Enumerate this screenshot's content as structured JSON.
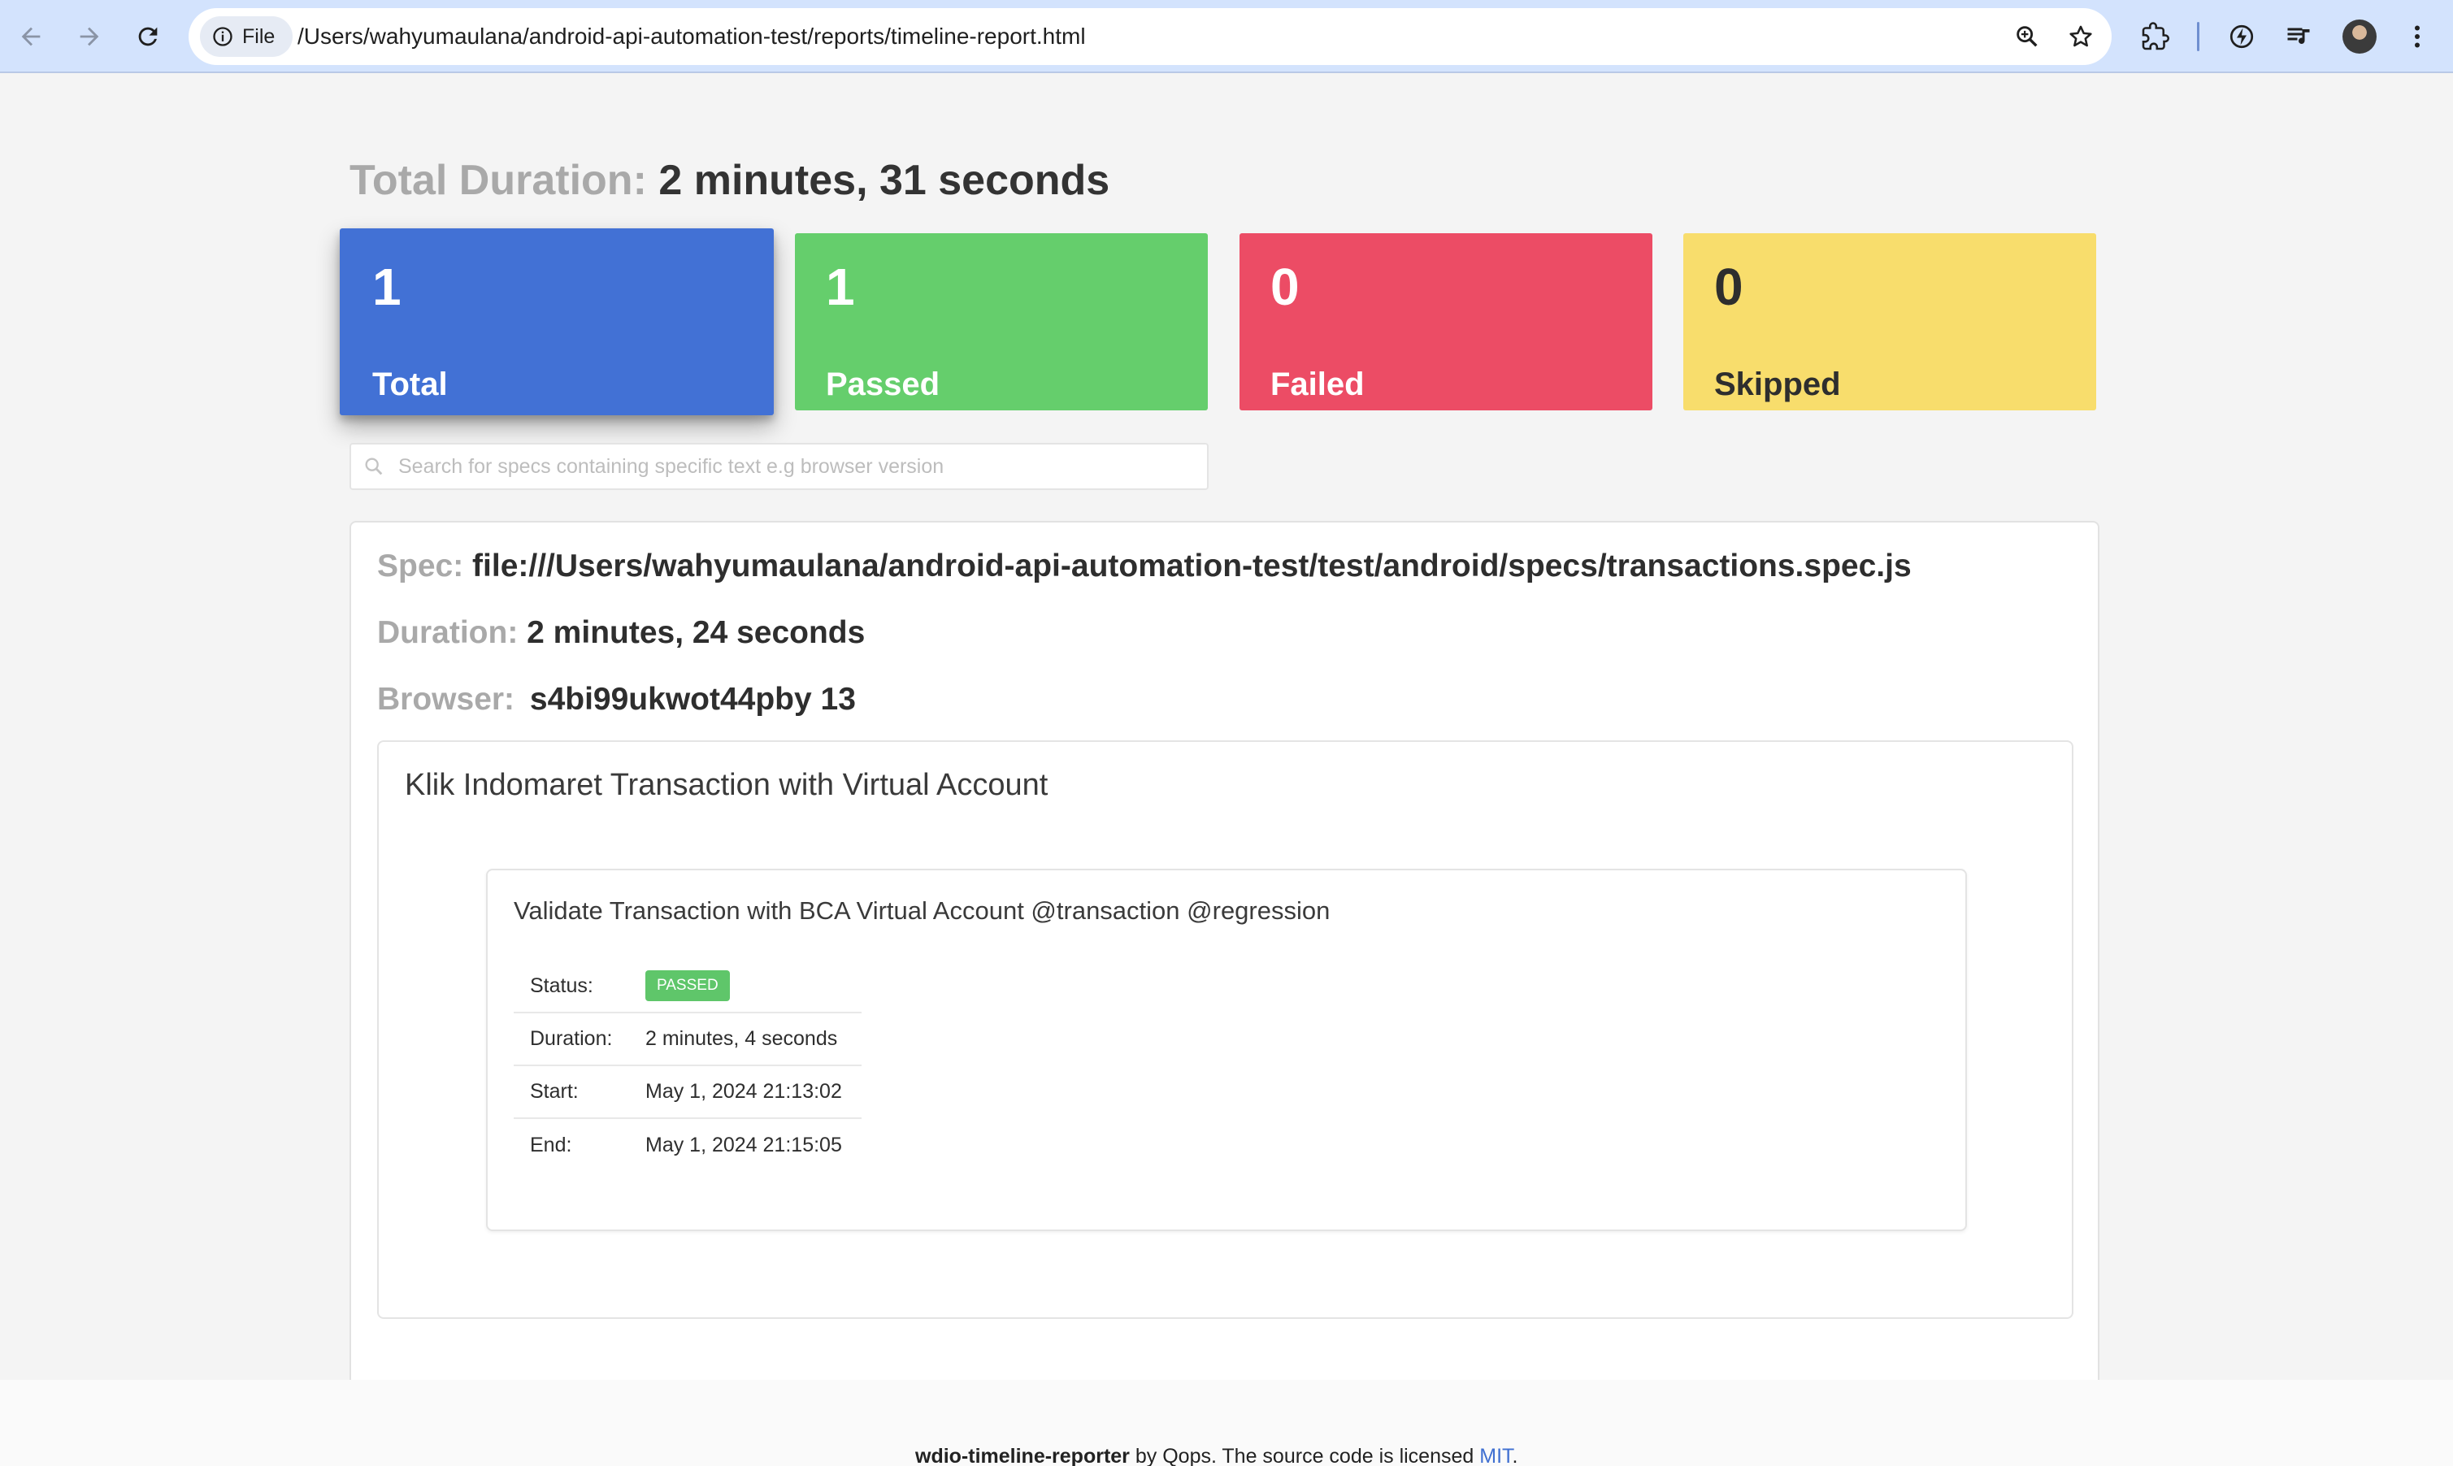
{
  "browser": {
    "site_chip": "File",
    "url": "/Users/wahyumaulana/android-api-automation-test/reports/timeline-report.html",
    "icons": [
      "back-arrow-icon",
      "forward-arrow-icon",
      "reload-icon",
      "info-icon",
      "zoom-icon",
      "star-icon",
      "extensions-icon",
      "performance-icon",
      "media-icon",
      "avatar",
      "kebab-menu-icon"
    ]
  },
  "summary": {
    "total_duration_label": "Total Duration:",
    "total_duration_value": "2 minutes, 31 seconds",
    "cards": [
      {
        "count": "1",
        "label": "Total",
        "color": "#4271d5"
      },
      {
        "count": "1",
        "label": "Passed",
        "color": "#65ce6c"
      },
      {
        "count": "0",
        "label": "Failed",
        "color": "#ec4c65"
      },
      {
        "count": "0",
        "label": "Skipped",
        "color": "#f8dd6c"
      }
    ]
  },
  "search": {
    "placeholder": "Search for specs containing specific text e.g browser version",
    "value": ""
  },
  "spec": {
    "spec_label": "Spec:",
    "spec_value": "file:///Users/wahyumaulana/android-api-automation-test/test/android/specs/transactions.spec.js",
    "duration_label": "Duration:",
    "duration_value": "2 minutes, 24 seconds",
    "browser_label": "Browser:",
    "browser_value": "s4bi99ukwot44pby 13",
    "suite": {
      "title": "Klik Indomaret Transaction with Virtual Account",
      "test": {
        "title": "Validate Transaction with BCA Virtual Account @transaction @regression",
        "status_label": "Status:",
        "status_value": "PASSED",
        "duration_label": "Duration:",
        "duration_value": "2 minutes, 4 seconds",
        "start_label": "Start:",
        "start_value": "May 1, 2024 21:13:02",
        "end_label": "End:",
        "end_value": "May 1, 2024 21:15:05"
      }
    }
  },
  "footer": {
    "name": "wdio-timeline-reporter",
    "middle": " by Qops. The source code is licensed ",
    "license": "MIT",
    "end": "."
  }
}
